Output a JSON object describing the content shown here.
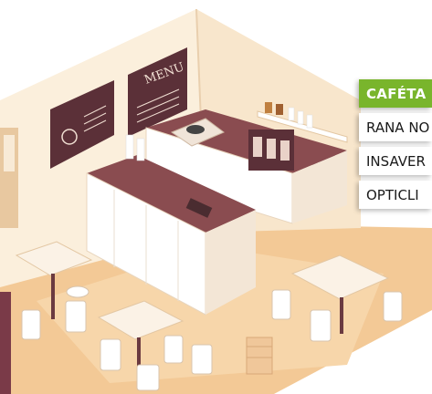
{
  "menu": {
    "items": [
      {
        "label": "CAFÉTA",
        "active": true
      },
      {
        "label": "RANA NO",
        "active": false
      },
      {
        "label": "INSAVER",
        "active": false
      },
      {
        "label": "OPTICLI",
        "active": false
      }
    ]
  },
  "scene": {
    "chalkboard_menu_title": "MENU",
    "colors": {
      "wall": "#fbefdc",
      "wall_shadow": "#f2d7b3",
      "floor": "#f3c996",
      "floor_light": "#f7d6aa",
      "counter": "#ffffff",
      "counter_top": "#8a4c50",
      "chalkboard": "#5b3038",
      "accent_green": "#79b52c"
    }
  }
}
